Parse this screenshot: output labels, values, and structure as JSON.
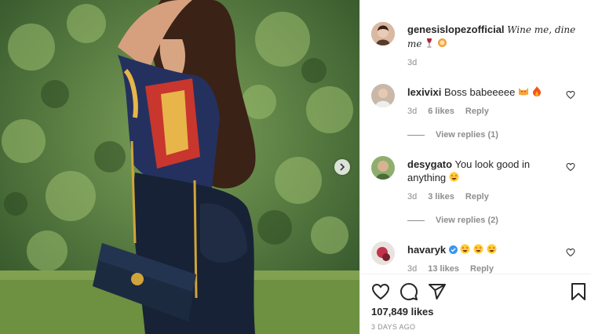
{
  "post": {
    "image_alt": "Woman in patterned shirt with shoulder bag in front of hedge",
    "likes": "107,849 likes",
    "time": "3 DAYS AGO"
  },
  "caption": {
    "username": "genesislopezofficial",
    "text": "Wine me, dine me",
    "emojis": [
      "wine-glass-icon",
      "fork-plate-icon"
    ],
    "age": "3d"
  },
  "comments": [
    {
      "username": "lexivixi",
      "text": "Boss babeeeee",
      "emojis": [
        "heart-eyes-cat-icon",
        "fire-icon"
      ],
      "age": "3d",
      "likes": "6 likes",
      "reply": "Reply",
      "view_replies": "View replies (1)"
    },
    {
      "username": "desygato",
      "text": "You look good in anything",
      "emojis": [
        "heart-eyes-icon"
      ],
      "age": "3d",
      "likes": "3 likes",
      "reply": "Reply",
      "view_replies": "View replies (2)"
    },
    {
      "username": "havaryk",
      "text": "",
      "verified": true,
      "emojis": [
        "heart-eyes-icon",
        "heart-eyes-icon",
        "heart-eyes-icon"
      ],
      "age": "3d",
      "likes": "13 likes",
      "reply": "Reply"
    }
  ],
  "colors": {
    "text": "#262626",
    "muted": "#8e8e8e",
    "verified": "#3897f0",
    "border": "#efefef"
  }
}
